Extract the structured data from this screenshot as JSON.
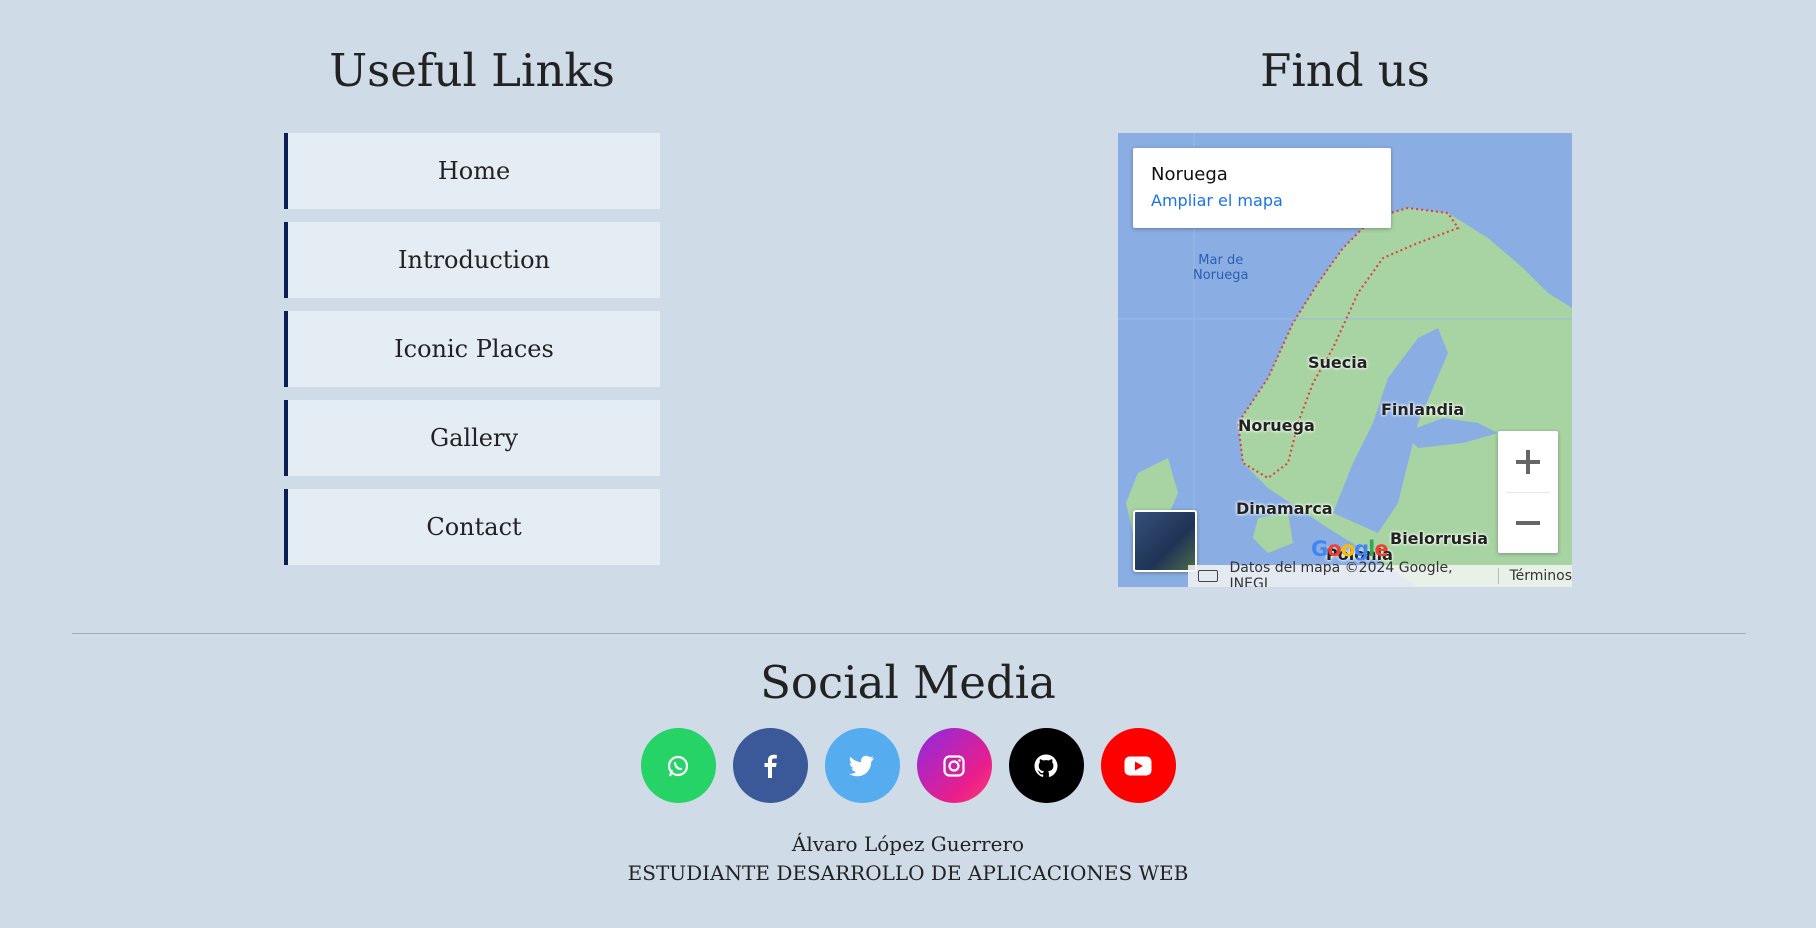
{
  "useful_links": {
    "title": "Useful Links",
    "items": [
      "Home",
      "Introduction",
      "Iconic Places",
      "Gallery",
      "Contact"
    ]
  },
  "find_us": {
    "title": "Find us",
    "map": {
      "place_title": "Noruega",
      "place_link": "Ampliar el mapa",
      "labels": {
        "sea": "Mar de Noruega",
        "sweden": "Suecia",
        "finland": "Finlandia",
        "norway": "Noruega",
        "denmark": "Dinamarca",
        "belarus": "Bielorrusia",
        "poland": "Polonia"
      },
      "attribution": "Datos del mapa ©2024 Google, INEGI",
      "terms": "Términos",
      "logo": "Google"
    }
  },
  "social_media": {
    "title": "Social Media",
    "items": [
      {
        "name": "WhatsApp",
        "icon": "whatsapp-icon",
        "color": "#25d366",
        "glyph": "✆"
      },
      {
        "name": "Facebook",
        "icon": "facebook-icon",
        "color": "#3b5998",
        "glyph": "f"
      },
      {
        "name": "Twitter",
        "icon": "twitter-icon",
        "color": "#55acee",
        "glyph": "🐦"
      },
      {
        "name": "Instagram",
        "icon": "instagram-icon",
        "color": "#c51fc9",
        "glyph": "◎"
      },
      {
        "name": "GitHub",
        "icon": "github-icon",
        "color": "#000000",
        "glyph": "●"
      },
      {
        "name": "YouTube",
        "icon": "youtube-icon",
        "color": "#ff0000",
        "glyph": "▶"
      }
    ]
  },
  "credit": {
    "name": "Álvaro López Guerrero",
    "role": "ESTUDIANTE DESARROLLO DE APLICACIONES WEB"
  }
}
